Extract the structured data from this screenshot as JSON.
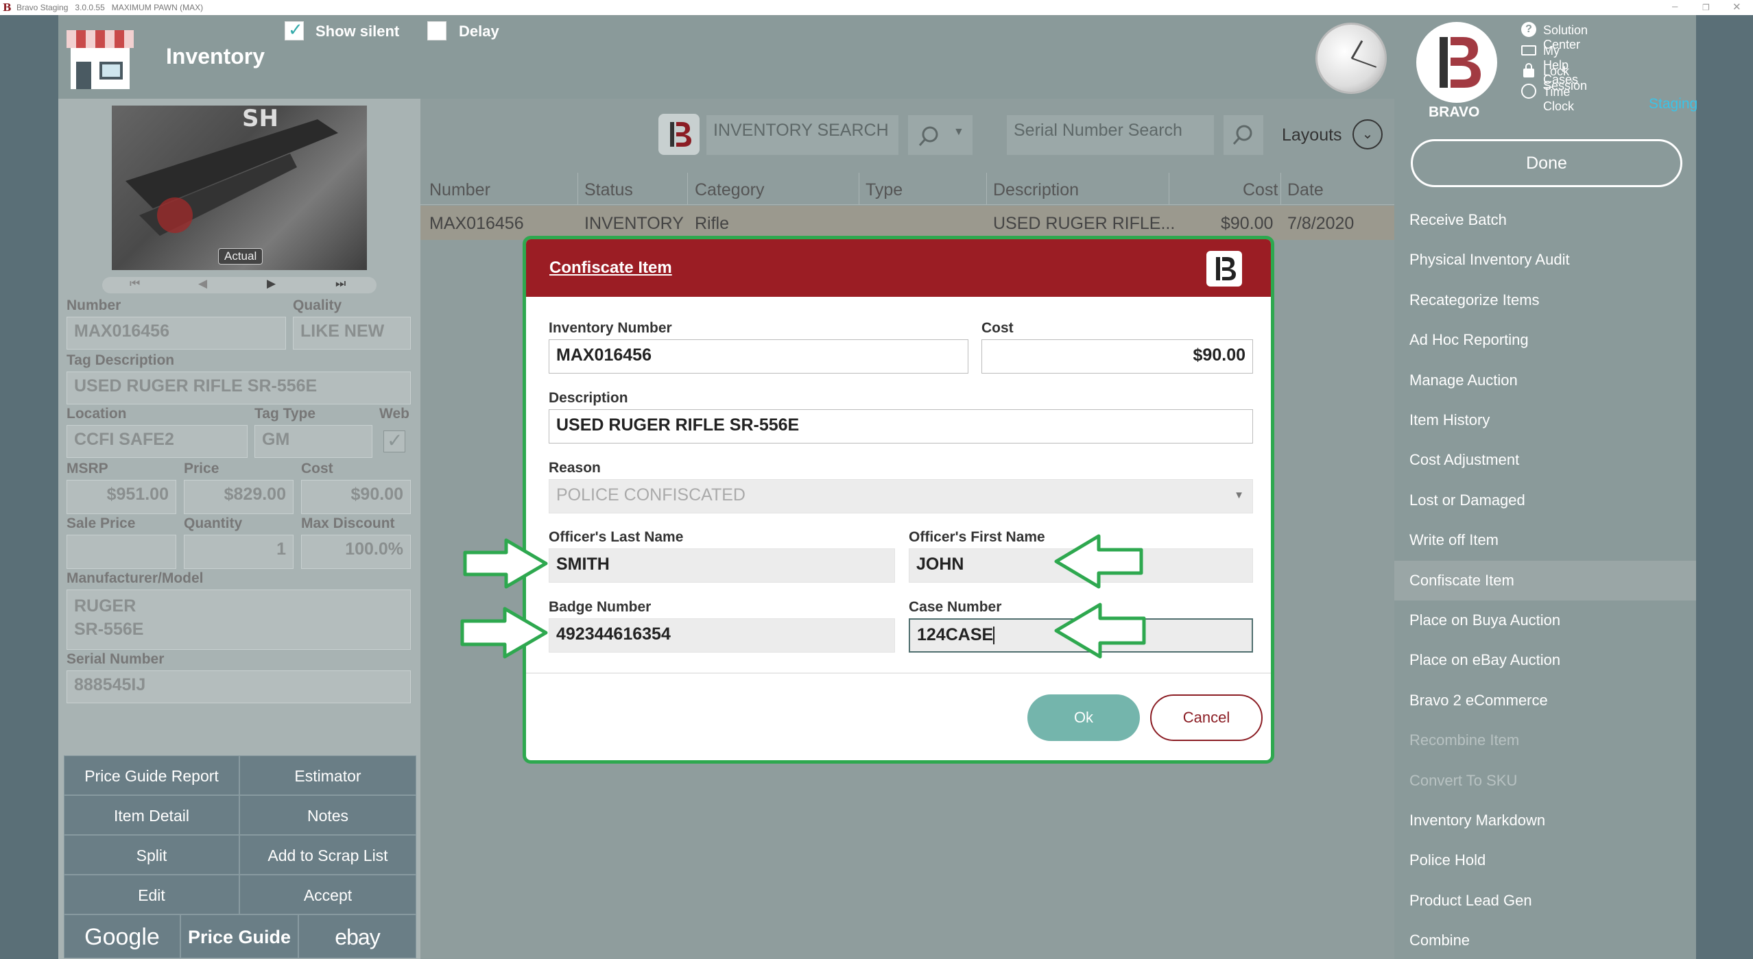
{
  "titlebar": {
    "app": "Bravo Staging",
    "version": "3.0.0.55",
    "store": "MAXIMUM PAWN (MAX)"
  },
  "header": {
    "title": "Inventory",
    "show_silent": "Show silent",
    "delay": "Delay"
  },
  "brand": {
    "name": "BRAVO",
    "env": "Staging"
  },
  "links": [
    "Solution Center",
    "My Help Cases",
    "Lock Session",
    "Time Clock"
  ],
  "photo": {
    "badge": "Actual"
  },
  "item": {
    "number_label": "Number",
    "number": "MAX016456",
    "quality_label": "Quality",
    "quality": "LIKE NEW",
    "tagdesc_label": "Tag Description",
    "tagdesc": "USED RUGER RIFLE SR-556E",
    "location_label": "Location",
    "location": "CCFI SAFE2",
    "tagtype_label": "Tag Type",
    "tagtype": "GM",
    "web_label": "Web",
    "msrp_label": "MSRP",
    "msrp": "$951.00",
    "price_label": "Price",
    "price": "$829.00",
    "cost_label": "Cost",
    "cost": "$90.00",
    "saleprice_label": "Sale Price",
    "saleprice": "",
    "quantity_label": "Quantity",
    "quantity": "1",
    "maxdiscount_label": "Max Discount",
    "maxdiscount": "100.0%",
    "mfr_label": "Manufacturer/Model",
    "mfr_line1": "RUGER",
    "mfr_line2": "SR-556E",
    "serial_label": "Serial Number",
    "serial": "888545IJ"
  },
  "actions": {
    "price_guide_report": "Price Guide Report",
    "estimator": "Estimator",
    "item_detail": "Item Detail",
    "notes": "Notes",
    "split": "Split",
    "add_to_scrap": "Add to Scrap List",
    "edit": "Edit",
    "accept": "Accept",
    "google": "Google",
    "price_guide": "Price Guide",
    "ebay": "ebay"
  },
  "search": {
    "inventory_placeholder": "INVENTORY SEARCH",
    "serial_placeholder": "Serial Number Search",
    "layouts": "Layouts"
  },
  "table": {
    "columns": [
      "Number",
      "Status",
      "Category",
      "Type",
      "Description",
      "Cost",
      "Date"
    ],
    "row": [
      "MAX016456",
      "INVENTORY",
      "Rifle",
      "",
      "USED RUGER RIFLE...",
      "$90.00",
      "7/8/2020"
    ]
  },
  "menu": {
    "done": "Done",
    "items": [
      "Receive Batch",
      "Physical Inventory Audit",
      "Recategorize Items",
      "Ad Hoc Reporting",
      "Manage Auction",
      "Item History",
      "Cost Adjustment",
      "Lost or Damaged",
      "Write off Item",
      "Confiscate Item",
      "Place on Buya Auction",
      "Place on eBay Auction",
      "Bravo 2 eCommerce",
      "Recombine Item",
      "Convert To SKU",
      "Inventory Markdown",
      "Police Hold",
      "Product Lead Gen",
      "Combine"
    ]
  },
  "dialog": {
    "title": "Confiscate Item",
    "inventory_number_label": "Inventory Number",
    "inventory_number": "MAX016456",
    "cost_label": "Cost",
    "cost": "$90.00",
    "description_label": "Description",
    "description": "USED RUGER RIFLE SR-556E",
    "reason_label": "Reason",
    "reason": "POLICE CONFISCATED",
    "last_name_label": "Officer's Last Name",
    "last_name": "SMITH",
    "first_name_label": "Officer's First Name",
    "first_name": "JOHN",
    "badge_label": "Badge Number",
    "badge": "492344616354",
    "case_label": "Case Number",
    "case": "124CASE",
    "ok": "Ok",
    "cancel": "Cancel"
  },
  "colors": {
    "accent_red": "#9b1d24",
    "highlight_green": "#2ea84f",
    "ok_teal": "#74b5ac"
  }
}
